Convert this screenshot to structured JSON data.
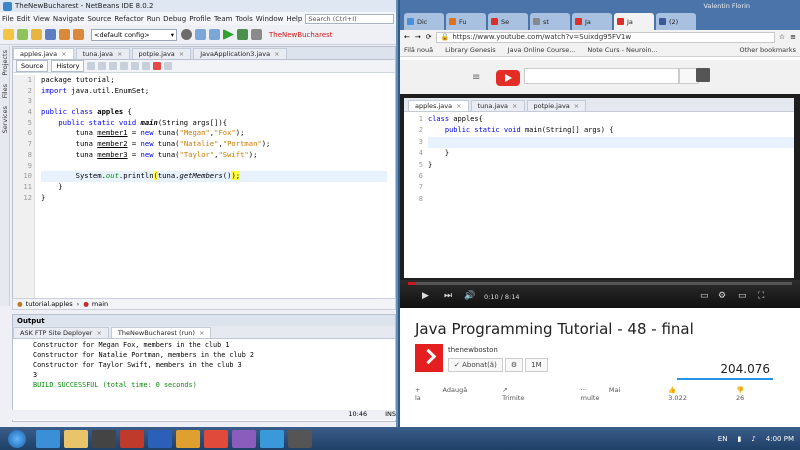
{
  "netbeans": {
    "title": "TheNewBucharest - NetBeans IDE 8.0.2",
    "menu": [
      "File",
      "Edit",
      "View",
      "Navigate",
      "Source",
      "Refactor",
      "Run",
      "Debug",
      "Profile",
      "Team",
      "Tools",
      "Window",
      "Help"
    ],
    "search_placeholder": "Search (Ctrl+I)",
    "config": "<default config>",
    "project_label": "TheNewBucharest",
    "side_tabs": [
      "Projects",
      "Files",
      "Services"
    ],
    "tabs": [
      "apples.java",
      "tuna.java",
      "potpie.java",
      "JavaApplication3.java"
    ],
    "sub_buttons": [
      "Source",
      "History"
    ],
    "line_numbers": [
      "1",
      "2",
      "3",
      "4",
      "5",
      "6",
      "7",
      "8",
      "9",
      "10",
      "11",
      "12"
    ],
    "code": {
      "l1": "package tutorial;",
      "l2a": "import",
      "l2b": " java.util.EnumSet;",
      "l4a": "public class ",
      "l4b": "apples",
      "l4c": " {",
      "l5a": "    public static void ",
      "l5b": "main",
      "l5c": "(String args[]){",
      "l6a": "        tuna ",
      "l6b": "member1",
      "l6c": " = ",
      "l6d": "new",
      "l6e": " tuna(",
      "l6f": "\"Megan\"",
      "l6g": ",",
      "l6h": "\"Fox\"",
      "l6i": ");",
      "l7b": "member2",
      "l7f": "\"Natalie\"",
      "l7h": "\"Portman\"",
      "l8b": "member3",
      "l8f": "\"Taylor\"",
      "l8h": "\"Swift\"",
      "l10a": "        System.",
      "l10b": "out",
      "l10c": ".println",
      "l10d": "(",
      "l10e": "tuna.",
      "l10f": "getMembers",
      "l10g": "()",
      "l10h": ");",
      "l11": "    }",
      "l12": "}"
    },
    "breadcrumb": [
      "tutorial.apples",
      "main"
    ],
    "output": {
      "title": "Output",
      "tabs": [
        "ASK FTP Site Deployer",
        "TheNewBucharest (run)"
      ],
      "lines": [
        "Constructor for Megan Fox, members in the club 1",
        "Constructor for Natalie Portman, members in the club 2",
        "Constructor for Taylor Swift, members in the club 3",
        "3",
        "BUILD SUCCESSFUL (total time: 0 seconds)"
      ]
    },
    "status": {
      "position": "10:46",
      "mode": "INS"
    }
  },
  "chrome": {
    "tabs": [
      {
        "label": "Dic",
        "fav": "#4a90d9"
      },
      {
        "label": "Fu",
        "fav": "#e07020"
      },
      {
        "label": "Se",
        "fav": "#d9302a"
      },
      {
        "label": "st",
        "fav": "#888888"
      },
      {
        "label": "Ja",
        "fav": "#d9302a"
      },
      {
        "label": "Ja",
        "fav": "#d9302a",
        "active": true
      },
      {
        "label": "(2)",
        "fav": "#3b5998"
      }
    ],
    "user": "Valentin Florin",
    "url": "https://www.youtube.com/watch?v=Suixdg95FV1w",
    "bookmarks": [
      "Filă nouă",
      "Library Genesis",
      "Java Online Course...",
      "Note Curs - Neuroin...",
      "Other bookmarks"
    ]
  },
  "video": {
    "tabs": [
      "apples.java",
      "tuna.java",
      "potpie.java"
    ],
    "line_numbers": [
      "1",
      "2",
      "3",
      "4",
      "5",
      "6",
      "7",
      "8"
    ],
    "code": {
      "l1a": "class ",
      "l1b": "apples{",
      "l2a": "    public static void ",
      "l2b": "main(String[] args) {",
      "l4": "    }",
      "l5": "}"
    },
    "time": "0:10 / 8:14",
    "progress_fraction": 0.02
  },
  "youtube": {
    "title": "Java Programming Tutorial - 48 - final",
    "channel": "thenewboston",
    "subscribe": "Abonat(ă)",
    "subs_count": "1M",
    "views": "204.076",
    "actions": [
      "Adaugă la",
      "Trimite",
      "Mai multe"
    ],
    "likes": "3.022",
    "dislikes": "26"
  },
  "taskbar": {
    "lang": "EN",
    "time": "4:00 PM"
  }
}
